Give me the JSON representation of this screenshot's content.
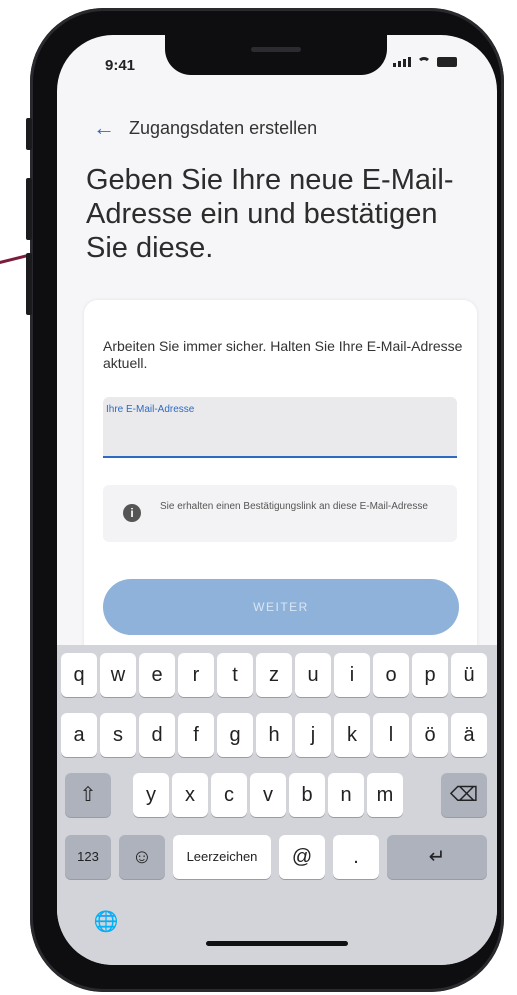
{
  "status_bar": {
    "time": "9:41"
  },
  "nav": {
    "back_icon": "arrow-left-icon",
    "title": "Zugangsdaten erstellen"
  },
  "headline": "Geben Sie Ihre neue E-Mail-Adresse ein und bestätigen Sie diese.",
  "card": {
    "description": "Arbeiten Sie immer sicher. Halten Sie Ihre E-Mail-Adresse aktuell.",
    "email_field": {
      "label": "Ihre E-Mail-Adresse",
      "value": ""
    },
    "info": {
      "icon": "info-icon",
      "text": "Sie erhalten einen Bestätigungslink an diese E-Mail-Adresse"
    },
    "button_label": "WEITER"
  },
  "keyboard": {
    "row1": [
      "q",
      "w",
      "e",
      "r",
      "t",
      "z",
      "u",
      "i",
      "o",
      "p",
      "ü"
    ],
    "row2": [
      "a",
      "s",
      "d",
      "f",
      "g",
      "h",
      "j",
      "k",
      "l",
      "ö",
      "ä"
    ],
    "row3": [
      "y",
      "x",
      "c",
      "v",
      "b",
      "n",
      "m"
    ],
    "numbers_label": "123",
    "space_label": "Leerzeichen",
    "at_label": "@",
    "dot_label": "."
  },
  "colors": {
    "accent": "#2d6ac2",
    "button_disabled": "#8fb2da",
    "callout": "#7a1d3c"
  }
}
